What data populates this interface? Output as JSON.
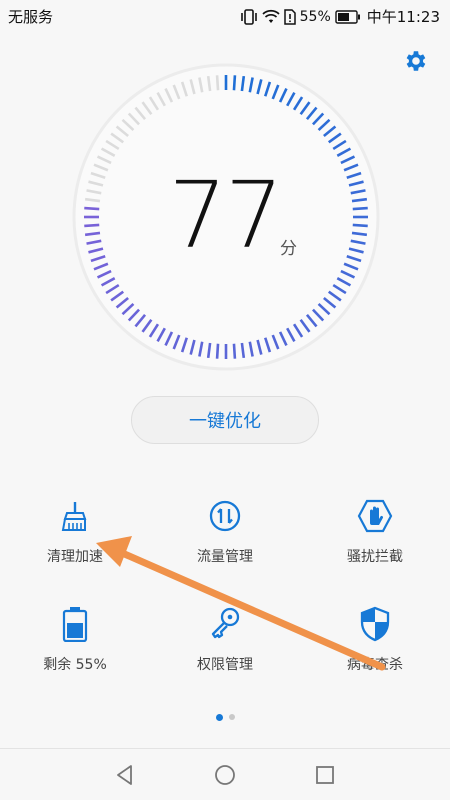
{
  "status_bar": {
    "carrier": "无服务",
    "battery_pct": "55%",
    "time": "中午11:23"
  },
  "settings": {
    "icon": "gear-icon"
  },
  "gauge": {
    "score": "77",
    "unit": "分",
    "score_fraction": 0.77,
    "active_color_start": "#1e6fd6",
    "active_color_end": "#7a62d8",
    "inactive_color": "#dcdcdc"
  },
  "optimize_button": {
    "label": "一键优化"
  },
  "tools": [
    {
      "label": "清理加速",
      "icon": "broom-icon"
    },
    {
      "label": "流量管理",
      "icon": "data-traffic-icon"
    },
    {
      "label": "骚扰拦截",
      "icon": "hand-block-icon"
    },
    {
      "label": "剩余 55%",
      "icon": "battery-icon"
    },
    {
      "label": "权限管理",
      "icon": "key-icon"
    },
    {
      "label": "病毒查杀",
      "icon": "shield-icon"
    }
  ],
  "pager": {
    "pages": 2,
    "active": 0
  },
  "colors": {
    "accent": "#1779d6",
    "annotation": "#f0924a"
  }
}
